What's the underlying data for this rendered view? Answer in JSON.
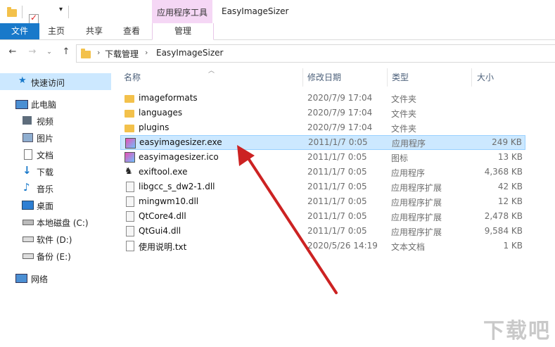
{
  "window_title": "EasyImageSizer",
  "contextual_tab_group": "应用程序工具",
  "ribbon": {
    "file": "文件",
    "tabs": [
      "主页",
      "共享",
      "查看"
    ],
    "manage": "管理"
  },
  "address": {
    "crumbs": [
      "下载管理",
      "EasyImageSizer"
    ]
  },
  "nav": {
    "quick_access": "快速访问",
    "this_pc": "此电脑",
    "videos": "视频",
    "pictures": "图片",
    "documents": "文档",
    "downloads": "下载",
    "music": "音乐",
    "desktop": "桌面",
    "local_disk": "本地磁盘 (C:)",
    "software": "软件 (D:)",
    "backup": "备份 (E:)",
    "network": "网络"
  },
  "columns": {
    "name": "名称",
    "date": "修改日期",
    "type": "类型",
    "size": "大小"
  },
  "files": [
    {
      "name": "imageformats",
      "date": "2020/7/9 17:04",
      "type": "文件夹",
      "size": "",
      "icon": "folder-icon"
    },
    {
      "name": "languages",
      "date": "2020/7/9 17:04",
      "type": "文件夹",
      "size": "",
      "icon": "folder-icon"
    },
    {
      "name": "plugins",
      "date": "2020/7/9 17:04",
      "type": "文件夹",
      "size": "",
      "icon": "folder-icon"
    },
    {
      "name": "easyimagesizer.exe",
      "date": "2011/1/7 0:05",
      "type": "应用程序",
      "size": "249 KB",
      "icon": "app-icon",
      "selected": true
    },
    {
      "name": "easyimagesizer.ico",
      "date": "2011/1/7 0:05",
      "type": "图标",
      "size": "13 KB",
      "icon": "app-icon"
    },
    {
      "name": "exiftool.exe",
      "date": "2011/1/7 0:05",
      "type": "应用程序",
      "size": "4,368 KB",
      "icon": "camel-icon"
    },
    {
      "name": "libgcc_s_dw2-1.dll",
      "date": "2011/1/7 0:05",
      "type": "应用程序扩展",
      "size": "42 KB",
      "icon": "dll-icon"
    },
    {
      "name": "mingwm10.dll",
      "date": "2011/1/7 0:05",
      "type": "应用程序扩展",
      "size": "12 KB",
      "icon": "dll-icon"
    },
    {
      "name": "QtCore4.dll",
      "date": "2011/1/7 0:05",
      "type": "应用程序扩展",
      "size": "2,478 KB",
      "icon": "dll-icon"
    },
    {
      "name": "QtGui4.dll",
      "date": "2011/1/7 0:05",
      "type": "应用程序扩展",
      "size": "9,584 KB",
      "icon": "dll-icon"
    },
    {
      "name": "使用说明.txt",
      "date": "2020/5/26 14:19",
      "type": "文本文档",
      "size": "1 KB",
      "icon": "text-file-icon"
    }
  ],
  "watermark": "下载吧",
  "colors": {
    "accent": "#1979ca",
    "selection": "#cce8ff",
    "contextual": "#f5d7f5",
    "arrow": "#cc2222"
  }
}
